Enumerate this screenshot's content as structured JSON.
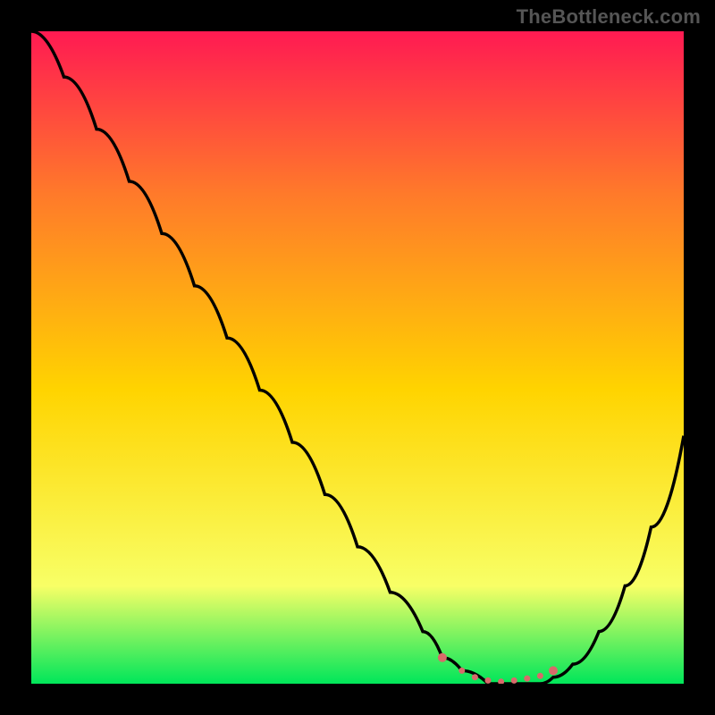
{
  "watermark": "TheBottleneck.com",
  "colors": {
    "frame": "#000000",
    "gradient_top": "#ff1a52",
    "gradient_mid": "#ffd400",
    "gradient_bottom": "#00e65a",
    "curve": "#000000",
    "marker": "#d86a6a"
  },
  "chart_data": {
    "type": "line",
    "title": "",
    "xlabel": "",
    "ylabel": "",
    "xlim": [
      0,
      100
    ],
    "ylim": [
      0,
      100
    ],
    "series": [
      {
        "name": "bottleneck-curve",
        "x": [
          0,
          5,
          10,
          15,
          20,
          25,
          30,
          35,
          40,
          45,
          50,
          55,
          60,
          63,
          66,
          70,
          74,
          78,
          80,
          83,
          87,
          91,
          95,
          100
        ],
        "y": [
          100,
          93,
          85,
          77,
          69,
          61,
          53,
          45,
          37,
          29,
          21,
          14,
          8,
          4,
          2,
          0,
          0,
          0,
          1,
          3,
          8,
          15,
          24,
          38
        ]
      }
    ],
    "markers": {
      "name": "highlight-range",
      "x": [
        63,
        66,
        68,
        70,
        72,
        74,
        76,
        78,
        80
      ],
      "y": [
        4,
        2,
        1,
        0.5,
        0.3,
        0.5,
        0.8,
        1.2,
        2
      ]
    }
  }
}
